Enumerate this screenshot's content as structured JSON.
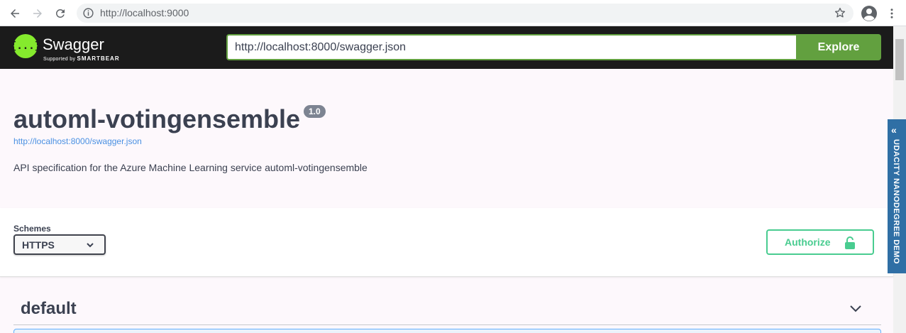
{
  "browser": {
    "url": "http://localhost:9000"
  },
  "topbar": {
    "logo_text": "Swagger",
    "logo_sub_prefix": "Supported by ",
    "logo_sub_brand": "SMARTBEAR",
    "logo_glyph": "{...}",
    "spec_url_value": "http://localhost:8000/swagger.json",
    "explore_label": "Explore",
    "brand_color": "#85ea2d",
    "accent_color": "#62a03f"
  },
  "info": {
    "title": "automl-votingensemble",
    "version": "1.0",
    "spec_link": "http://localhost:8000/swagger.json",
    "description": "API specification for the Azure Machine Learning service automl-votingensemble"
  },
  "schemes": {
    "label": "Schemes",
    "selected": "HTTPS",
    "authorize_label": "Authorize",
    "authorize_color": "#49cc90"
  },
  "tag": {
    "name": "default"
  },
  "side_tab": {
    "arrows": "«",
    "label": "UDACITY NANODEGREE DEMO",
    "color": "#2f6fa5"
  }
}
